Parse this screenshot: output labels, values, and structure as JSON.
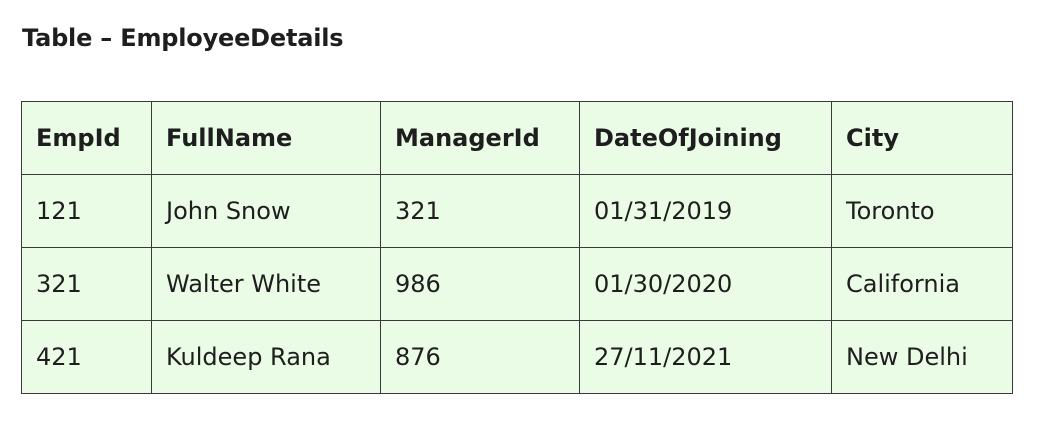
{
  "heading": "Table – EmployeeDetails",
  "table": {
    "columns": [
      "EmpId",
      "FullName",
      "ManagerId",
      "DateOfJoining",
      "City"
    ],
    "rows": [
      [
        "121",
        "John Snow",
        "321",
        "01/31/2019",
        "Toronto"
      ],
      [
        "321",
        "Walter White",
        "986",
        "01/30/2020",
        "California"
      ],
      [
        "421",
        "Kuldeep Rana",
        "876",
        "27/11/2021",
        "New Delhi"
      ]
    ]
  },
  "colors": {
    "table_background": "#eafbe6",
    "border": "#3a3a3a",
    "text": "#1e1e1e"
  }
}
